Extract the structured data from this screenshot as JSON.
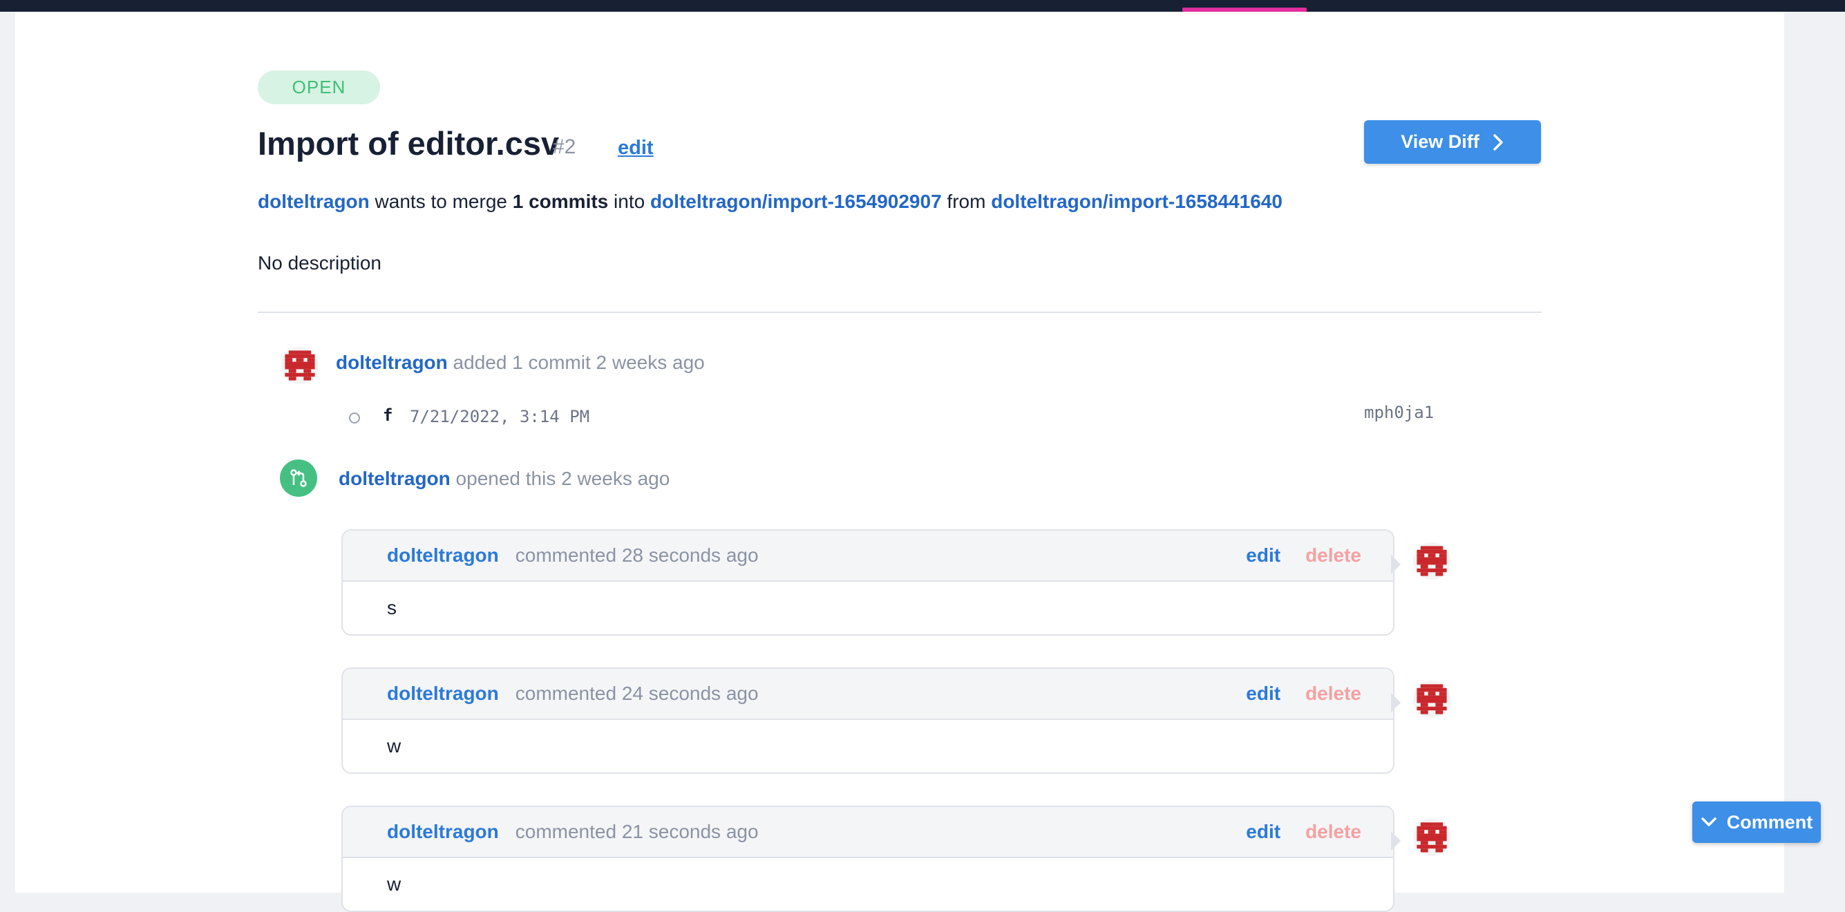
{
  "pull_request": {
    "state": "OPEN",
    "title": "Import of editor.csv",
    "number": "#2",
    "edit_label": "edit",
    "view_diff_label": "View Diff",
    "author": "dolteltragon",
    "merge_text_1": " wants to merge ",
    "commit_count": "1 commits",
    "merge_text_2": " into ",
    "to_branch": "dolteltragon/import-1654902907",
    "merge_text_3": " from ",
    "from_branch": "dolteltragon/import-1658441640",
    "description": "No description"
  },
  "timeline": {
    "commit_event": {
      "user": "dolteltragon",
      "text": " added 1 commit 2 weeks ago"
    },
    "commit": {
      "message": "f",
      "date": "7/21/2022, 3:14 PM",
      "hash": "mph0ja1"
    },
    "opened_event": {
      "user": "dolteltragon",
      "text": " opened this 2 weeks ago"
    }
  },
  "comments": [
    {
      "user": "dolteltragon",
      "time": "commented 28 seconds ago",
      "edit": "edit",
      "delete": "delete",
      "body": "s"
    },
    {
      "user": "dolteltragon",
      "time": "commented 24 seconds ago",
      "edit": "edit",
      "delete": "delete",
      "body": "w"
    },
    {
      "user": "dolteltragon",
      "time": "commented 21 seconds ago",
      "edit": "edit",
      "delete": "delete",
      "body": "w"
    }
  ],
  "comment_button_label": "Comment",
  "colors": {
    "accent": "#3d8fe8",
    "link": "#2367c6",
    "open_badge_bg": "#d7f3e3",
    "open_badge_text": "#3fbf78",
    "delete": "#f4a1a1",
    "avatar_red": "#c8282c",
    "nav_indicator": "#e22e9e"
  },
  "icons": [
    "chevron-right-icon",
    "git-pull-request-icon",
    "chevron-down-icon",
    "avatar-identicon"
  ]
}
